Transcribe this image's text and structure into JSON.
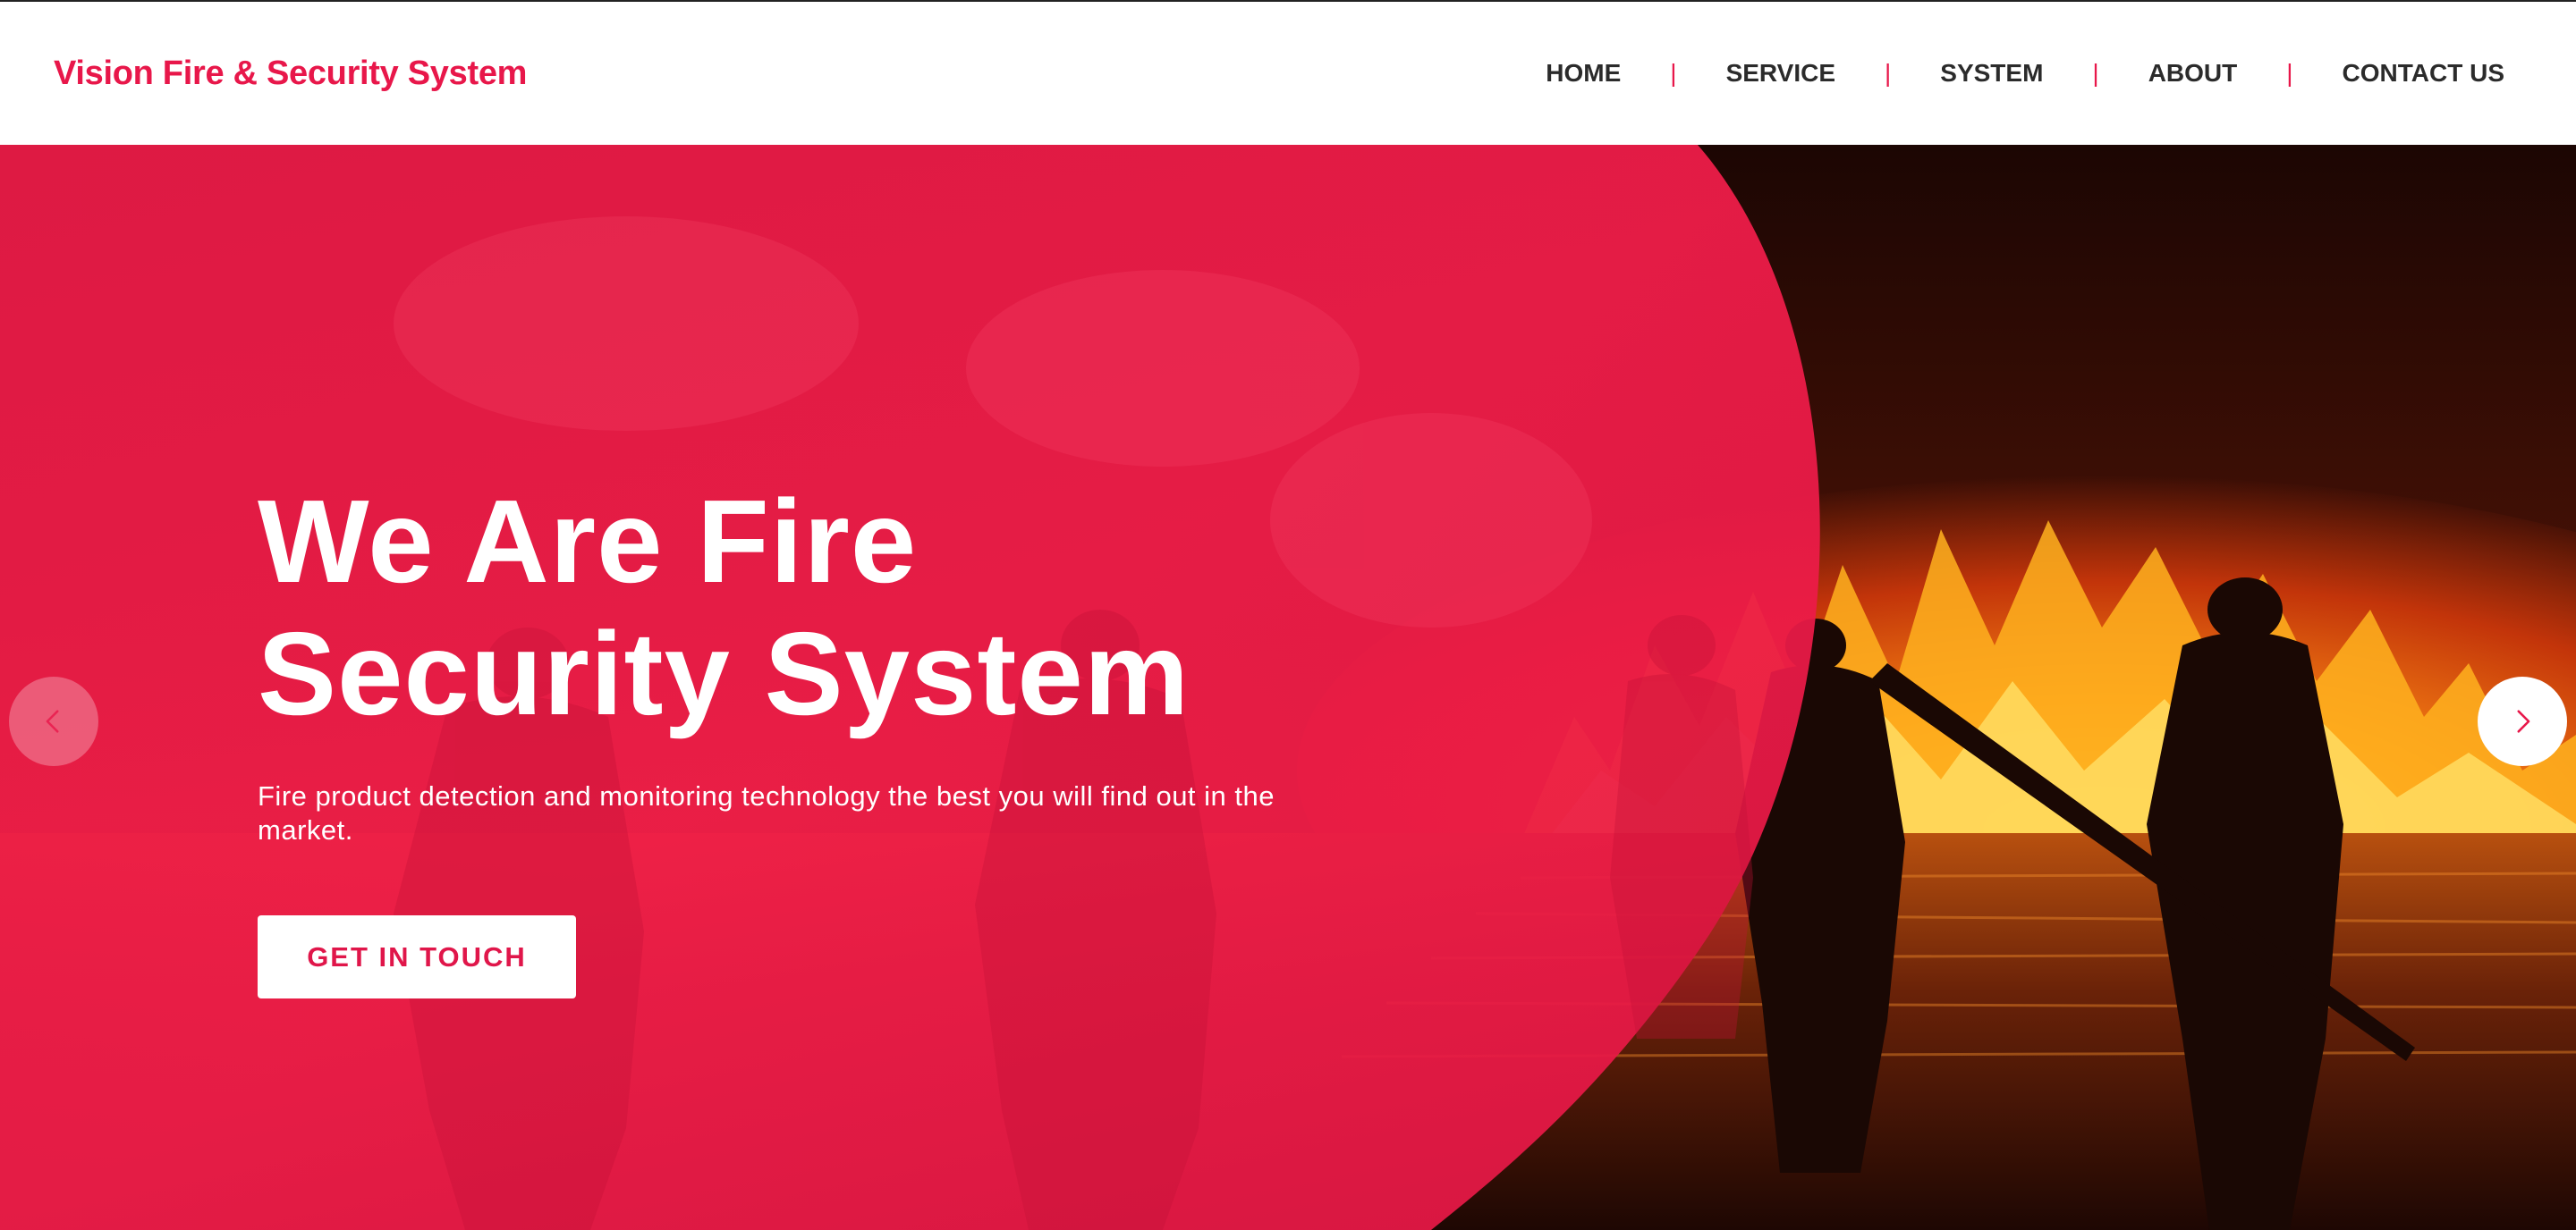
{
  "brand": {
    "name": "Vision Fire & Security System"
  },
  "nav": {
    "items": [
      {
        "label": "HOME"
      },
      {
        "label": "SERVICE"
      },
      {
        "label": "SYSTEM"
      },
      {
        "label": "ABOUT"
      },
      {
        "label": "CONTACT US"
      }
    ],
    "separator": "|"
  },
  "hero": {
    "title_line1": "We Are Fire",
    "title_line2": "Security System",
    "subtitle": "Fire product detection and monitoring technology the best you will find out in the market.",
    "cta_label": "GET IN TOUCH"
  },
  "carousel": {
    "prev_icon": "chevron-left-icon",
    "next_icon": "chevron-right-icon"
  },
  "colors": {
    "accent": "#e8174a",
    "nav_text": "#2b2b2b",
    "overlay": "#f0194b",
    "cta_text": "#e0164a"
  }
}
